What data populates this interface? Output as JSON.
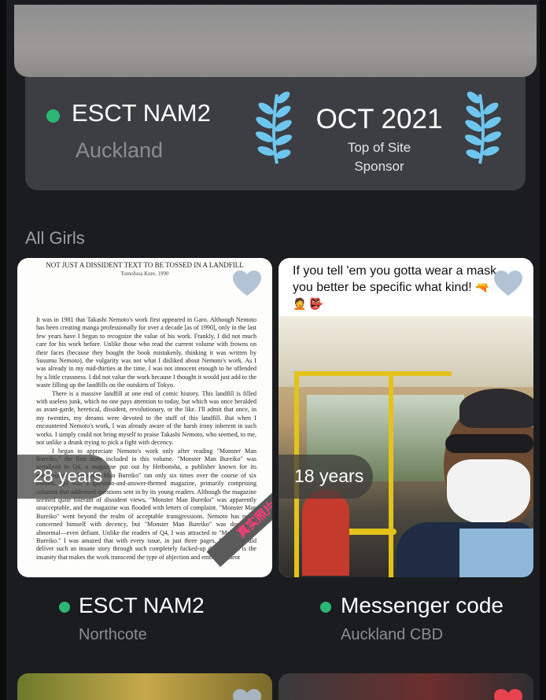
{
  "featured": {
    "name": "ESCT NAM2",
    "city": "Auckland",
    "status_color": "#2bb673",
    "award": {
      "date": "OCT 2021",
      "line1": "Top of Site",
      "line2": "Sponsor",
      "icon": "laurel-icon",
      "icon_color": "#6ec6ee"
    }
  },
  "section_title": "All Girls",
  "cards": [
    {
      "name": "ESCT NAM2",
      "city": "Northcote",
      "age": "28 years",
      "favorite_icon": "heart-icon",
      "document": {
        "header": "NOT JUST A DISSIDENT TEXT TO BE TOSSED IN A LANDFILL",
        "author": "Tomofusa Kure, 1990",
        "paragraphs": [
          "It was in 1981 that Takashi Nemoto's work first appeared in Garo. Although Nemoto has been creating manga professionally for over a decade [as of 1990], only in the last few years have I begun to recognize the value of his work. Frankly, I did not much care for his work before. Unlike those who read the current volume with frowns on their faces (because they bought the book mistakenly, thinking it was written by Susumu Nemoto), the vulgarity was not what I disliked about Nemoto's work. As I was already in my mid-thirties at the time, I was not innocent enough to be offended by a little crassness. I did not value the work because I thought it would just add to the waste filling up the landfills on the outskirts of Tokyo.",
          "There is a massive landfill at one end of comic history. This landfill is filled with useless junk, which no one pays attention to today, but which was once heralded as avant-garde, heretical, dissident, revolutionary, or the like. I'll admit that once, in my twenties, my dreams were devoted to the stuff of this landfill. But when I encountered Nemoto's work, I was already aware of the harsh irony inherent in such works. I simply could not bring myself to praise Takashi Nemoto, who seemed, to me, not unlike a drunk trying to pick a fight with decency.",
          "I began to appreciate Nemoto's work only after reading \"Monster Man Bureiko,\" the first story included in this volume. \"Monster Man Bureiko\" was serialized in Q4, a magazine put out by Heibonsha, a publisher known for its encyclopedias. \"Monster Man Bureiko\" ran only six times over the course of six months. Q4 was a question-and-answer-themed magazine, primarily comprising columns that addressed questions sent in by its young readers. Although the magazine seemed quite tolerant of dissident views, \"Monster Man Bureiko\" was apparently unacceptable, and the magazine was flooded with letters of complaint. \"Monster Man Bureiko\" went beyond the realm of acceptable transgressions. Nemoto has never concerned himself with decency, but \"Monster Man Bureiko\" was downright abnormal—even defiant. Unlike the readers of Q4, I was attracted to \"Monster Man Bureiko.\" I was amazed that with every issue, in just three pages, Nemoto could deliver such an insane story through such completely fucked-up drawings. It is the insanity that makes the work transcend the type of abjection and embarrassment"
        ],
        "watermark": "真实照片"
      }
    },
    {
      "name": "Messenger code",
      "city": "Auckland CBD",
      "age": "18 years",
      "favorite_icon": "heart-icon",
      "caption": "If you tell 'em you gotta wear a mask you better be specific what kind!",
      "caption_emoji": "🔫 🤦 👺"
    }
  ],
  "colors": {
    "background": "#1b1c1f",
    "card_info_bg": "#3c3e43",
    "online": "#2bb673",
    "heart": "#aabdd0",
    "heart_active": "#e8434e"
  }
}
